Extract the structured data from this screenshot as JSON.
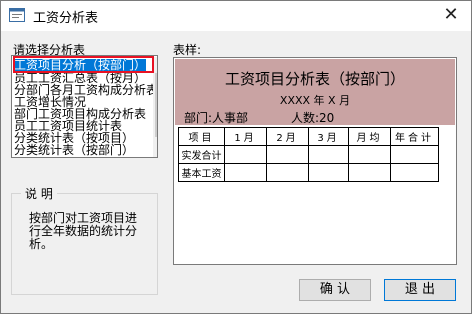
{
  "window": {
    "title": "工资分析表",
    "close_glyph": "✕"
  },
  "picker": {
    "label": "请选择分析表",
    "items": [
      "工资项目分析（按部门）",
      "员工工资汇总表（按月）",
      "分部门各月工资构成分析表",
      "工资增长情况",
      "部门工资项目构成分析表",
      "员工工资项目统计表",
      "分类统计表（按项目）",
      "分类统计表（按部门）"
    ],
    "selected_index": 0
  },
  "description": {
    "title": "说 明",
    "text": "按部门对工资项目进行全年数据的统计分析。"
  },
  "preview": {
    "label": "表样:",
    "title": "工资项目分析表（按部门）",
    "subtitle": "XXXX 年 X 月",
    "department": "部门:人事部",
    "headcount": "人数:20",
    "columns": [
      "项目",
      "1月",
      "2月",
      "3月",
      "月均",
      "年合计"
    ],
    "rows": [
      "实发合计",
      "基本工资"
    ]
  },
  "buttons": {
    "ok": "确 认",
    "exit": "退 出"
  },
  "colors": {
    "header_bg": "#c9a3a3",
    "selection": "#0078d7",
    "highlight_outline": "#e81123"
  }
}
